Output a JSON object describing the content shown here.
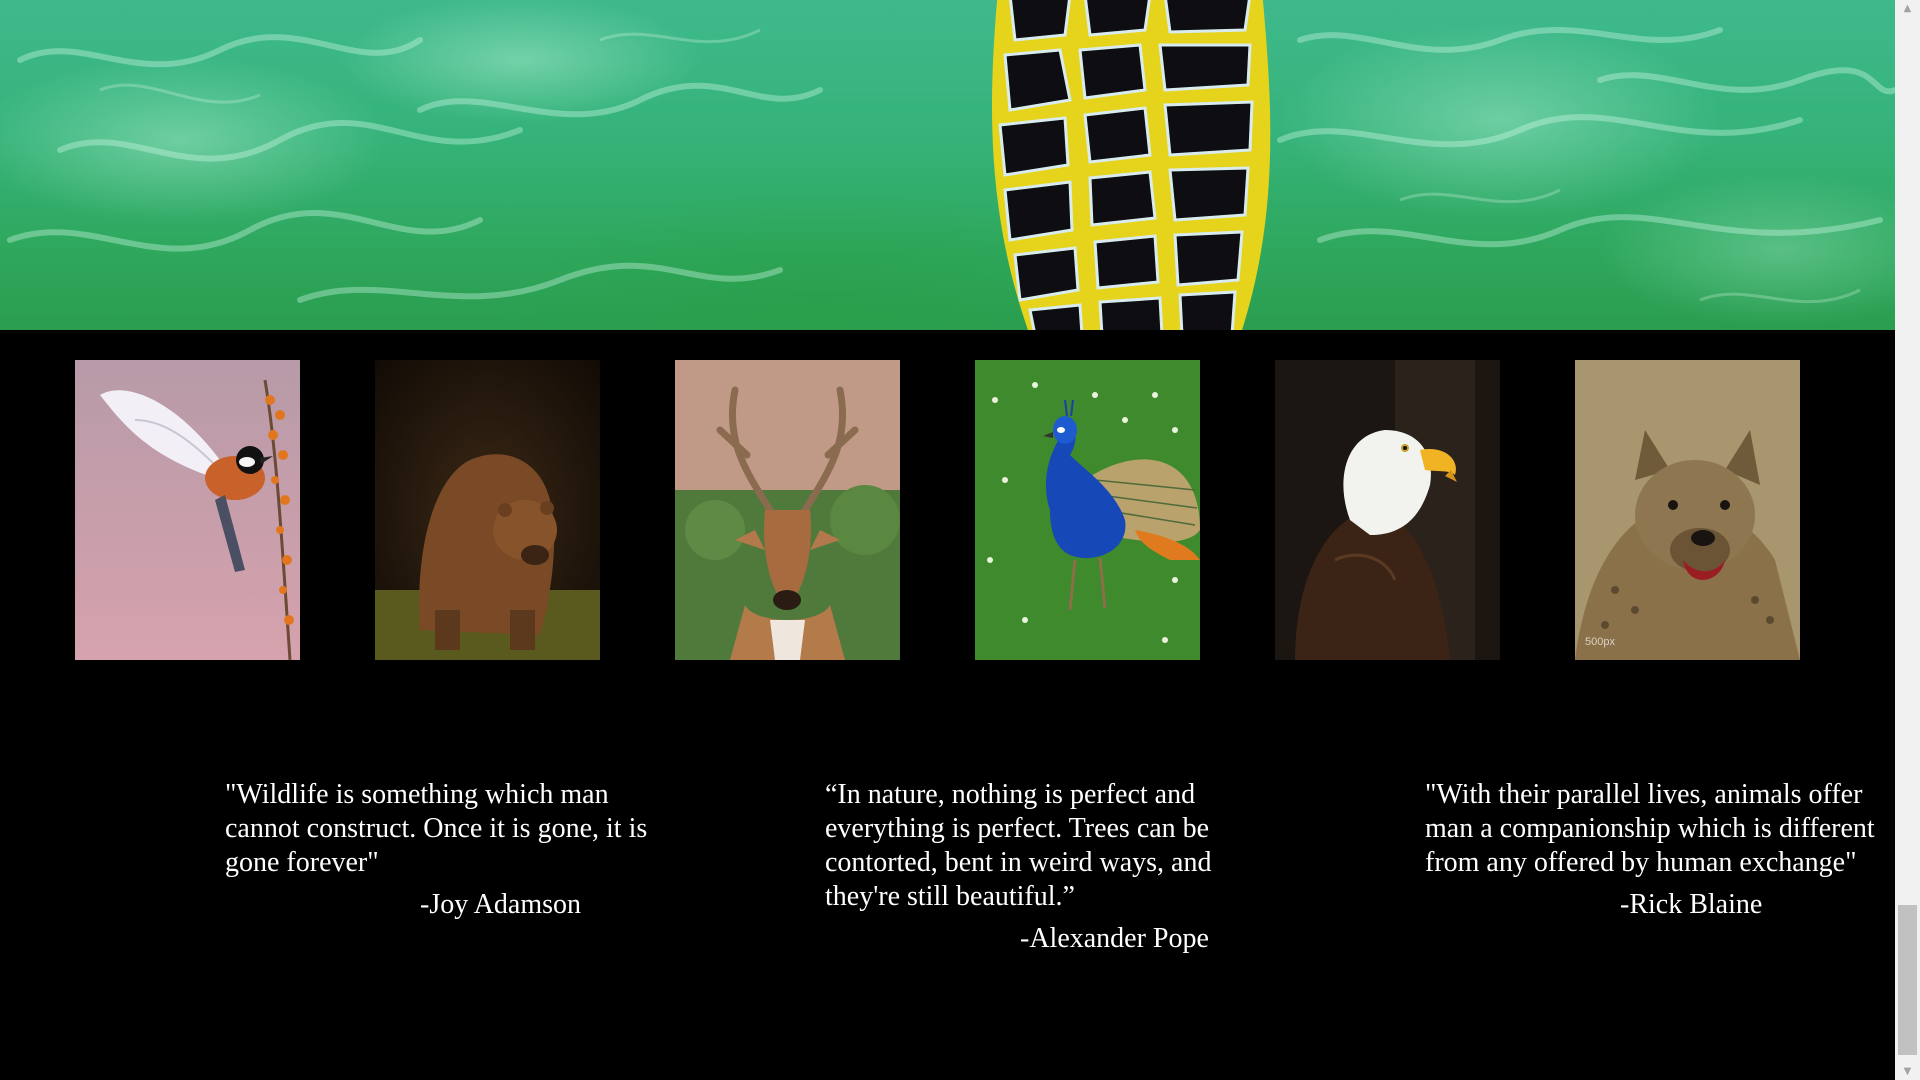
{
  "hero": {
    "image": "turtle-shell-in-water"
  },
  "gallery": {
    "images": [
      {
        "subject": "bird",
        "icon": "bird-photo"
      },
      {
        "subject": "bear",
        "icon": "bear-photo"
      },
      {
        "subject": "deer",
        "icon": "deer-photo"
      },
      {
        "subject": "peacock",
        "icon": "peacock-photo"
      },
      {
        "subject": "eagle",
        "icon": "eagle-photo"
      },
      {
        "subject": "hyena",
        "icon": "hyena-photo",
        "watermark": "500px"
      }
    ]
  },
  "quotes": [
    {
      "text": "\"Wildlife is something which man cannot construct. Once it is gone, it is gone forever\"",
      "author": "-Joy Adamson"
    },
    {
      "text": "“In nature, nothing is perfect and everything is perfect. Trees can be contorted, bent in weird ways, and they're still beautiful.”",
      "author": "-Alexander Pope"
    },
    {
      "text": "\"With their parallel lives, animals offer man a companionship which is different from any offered by human exchange\"",
      "author": "-Rick Blaine"
    }
  ],
  "scrollbar": {
    "up_arrow": "▲",
    "down_arrow": "▼",
    "position": 0.95
  },
  "colors": {
    "background": "#000000",
    "text": "#ffffff",
    "water": "#35b37a",
    "shell_yellow": "#e8d21a"
  }
}
